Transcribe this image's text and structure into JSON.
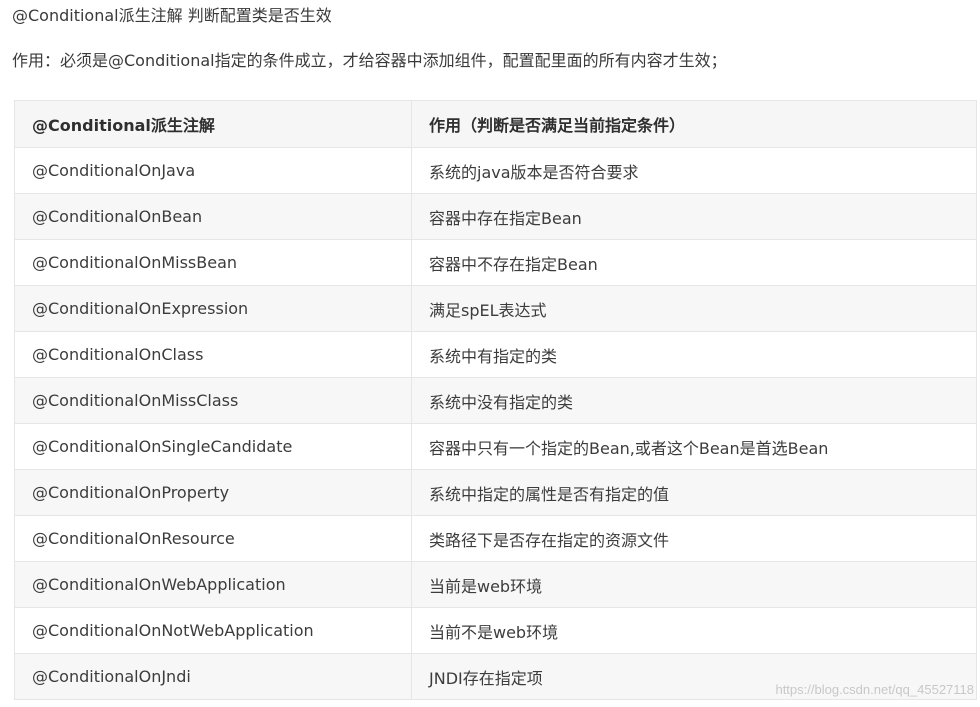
{
  "heading": "@Conditional派生注解  判断配置类是否生效",
  "intro": "作用：必须是@Conditional指定的条件成立，才给容器中添加组件，配置配里面的所有内容才生效；",
  "table": {
    "headers": [
      "@Conditional派生注解",
      "作用（判断是否满足当前指定条件）"
    ],
    "rows": [
      [
        "@ConditionalOnJava",
        "系统的java版本是否符合要求"
      ],
      [
        "@ConditionalOnBean",
        "容器中存在指定Bean"
      ],
      [
        "@ConditionalOnMissBean",
        "容器中不存在指定Bean"
      ],
      [
        "@ConditionalOnExpression",
        "满足spEL表达式"
      ],
      [
        "@ConditionalOnClass",
        "系统中有指定的类"
      ],
      [
        "@ConditionalOnMissClass",
        "系统中没有指定的类"
      ],
      [
        "@ConditionalOnSingleCandidate",
        "容器中只有一个指定的Bean,或者这个Bean是首选Bean"
      ],
      [
        "@ConditionalOnProperty",
        "系统中指定的属性是否有指定的值"
      ],
      [
        "@ConditionalOnResource",
        "类路径下是否存在指定的资源文件"
      ],
      [
        "@ConditionalOnWebApplication",
        "当前是web环境"
      ],
      [
        "@ConditionalOnNotWebApplication",
        "当前不是web环境"
      ],
      [
        "@ConditionalOnJndi",
        "JNDI存在指定项"
      ]
    ]
  },
  "watermark": "https://blog.csdn.net/qq_45527118"
}
